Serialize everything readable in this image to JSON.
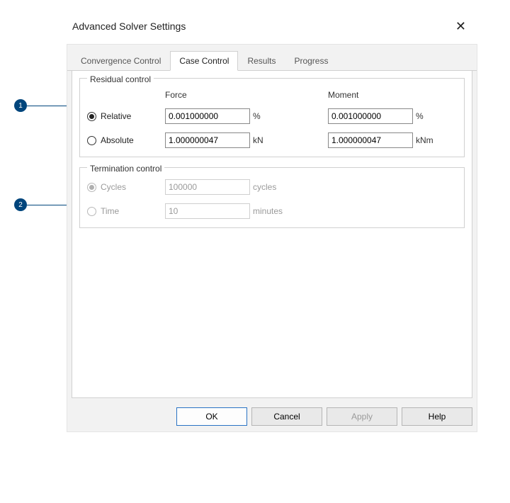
{
  "dialog": {
    "title": "Advanced Solver Settings"
  },
  "tabs": {
    "items": [
      {
        "label": "Convergence Control"
      },
      {
        "label": "Case Control"
      },
      {
        "label": "Results"
      },
      {
        "label": "Progress"
      }
    ]
  },
  "residual": {
    "legend": "Residual control",
    "force_header": "Force",
    "moment_header": "Moment",
    "relative_label": "Relative",
    "absolute_label": "Absolute",
    "rel_force_value": "0.001000000",
    "rel_force_unit": "%",
    "rel_moment_value": "0.001000000",
    "rel_moment_unit": "%",
    "abs_force_value": "1.000000047",
    "abs_force_unit": "kN",
    "abs_moment_value": "1.000000047",
    "abs_moment_unit": "kNm"
  },
  "termination": {
    "legend": "Termination control",
    "cycles_label": "Cycles",
    "cycles_value": "100000",
    "cycles_unit": "cycles",
    "time_label": "Time",
    "time_value": "10",
    "time_unit": "minutes"
  },
  "buttons": {
    "ok": "OK",
    "cancel": "Cancel",
    "apply": "Apply",
    "help": "Help"
  },
  "callouts": {
    "one": "1",
    "two": "2"
  }
}
